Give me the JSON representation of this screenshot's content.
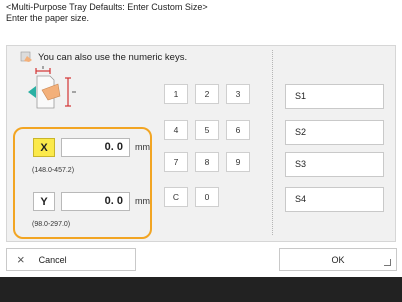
{
  "header": {
    "title": "<Multi-Purpose Tray Defaults: Enter Custom Size>",
    "instruction": "Enter the paper size."
  },
  "hint": {
    "text": "You can also use the numeric keys."
  },
  "dimensions": {
    "x": {
      "label": "X",
      "value": "0. 0",
      "unit": "mm",
      "range": "(148.0-457.2)"
    },
    "y": {
      "label": "Y",
      "value": "0. 0",
      "unit": "mm",
      "range": "(98.0-297.0)"
    }
  },
  "keypad": [
    "1",
    "2",
    "3",
    "4",
    "5",
    "6",
    "7",
    "8",
    "9",
    "C",
    "0"
  ],
  "memory": [
    "S1",
    "S2",
    "S3",
    "S4"
  ],
  "buttons": {
    "cancel": "Cancel",
    "ok": "OK"
  },
  "colors": {
    "highlight_border": "#f2a523",
    "active_axis": "#fbe94a",
    "arrow": "#2ab0a3",
    "size_marker": "#d33333"
  }
}
